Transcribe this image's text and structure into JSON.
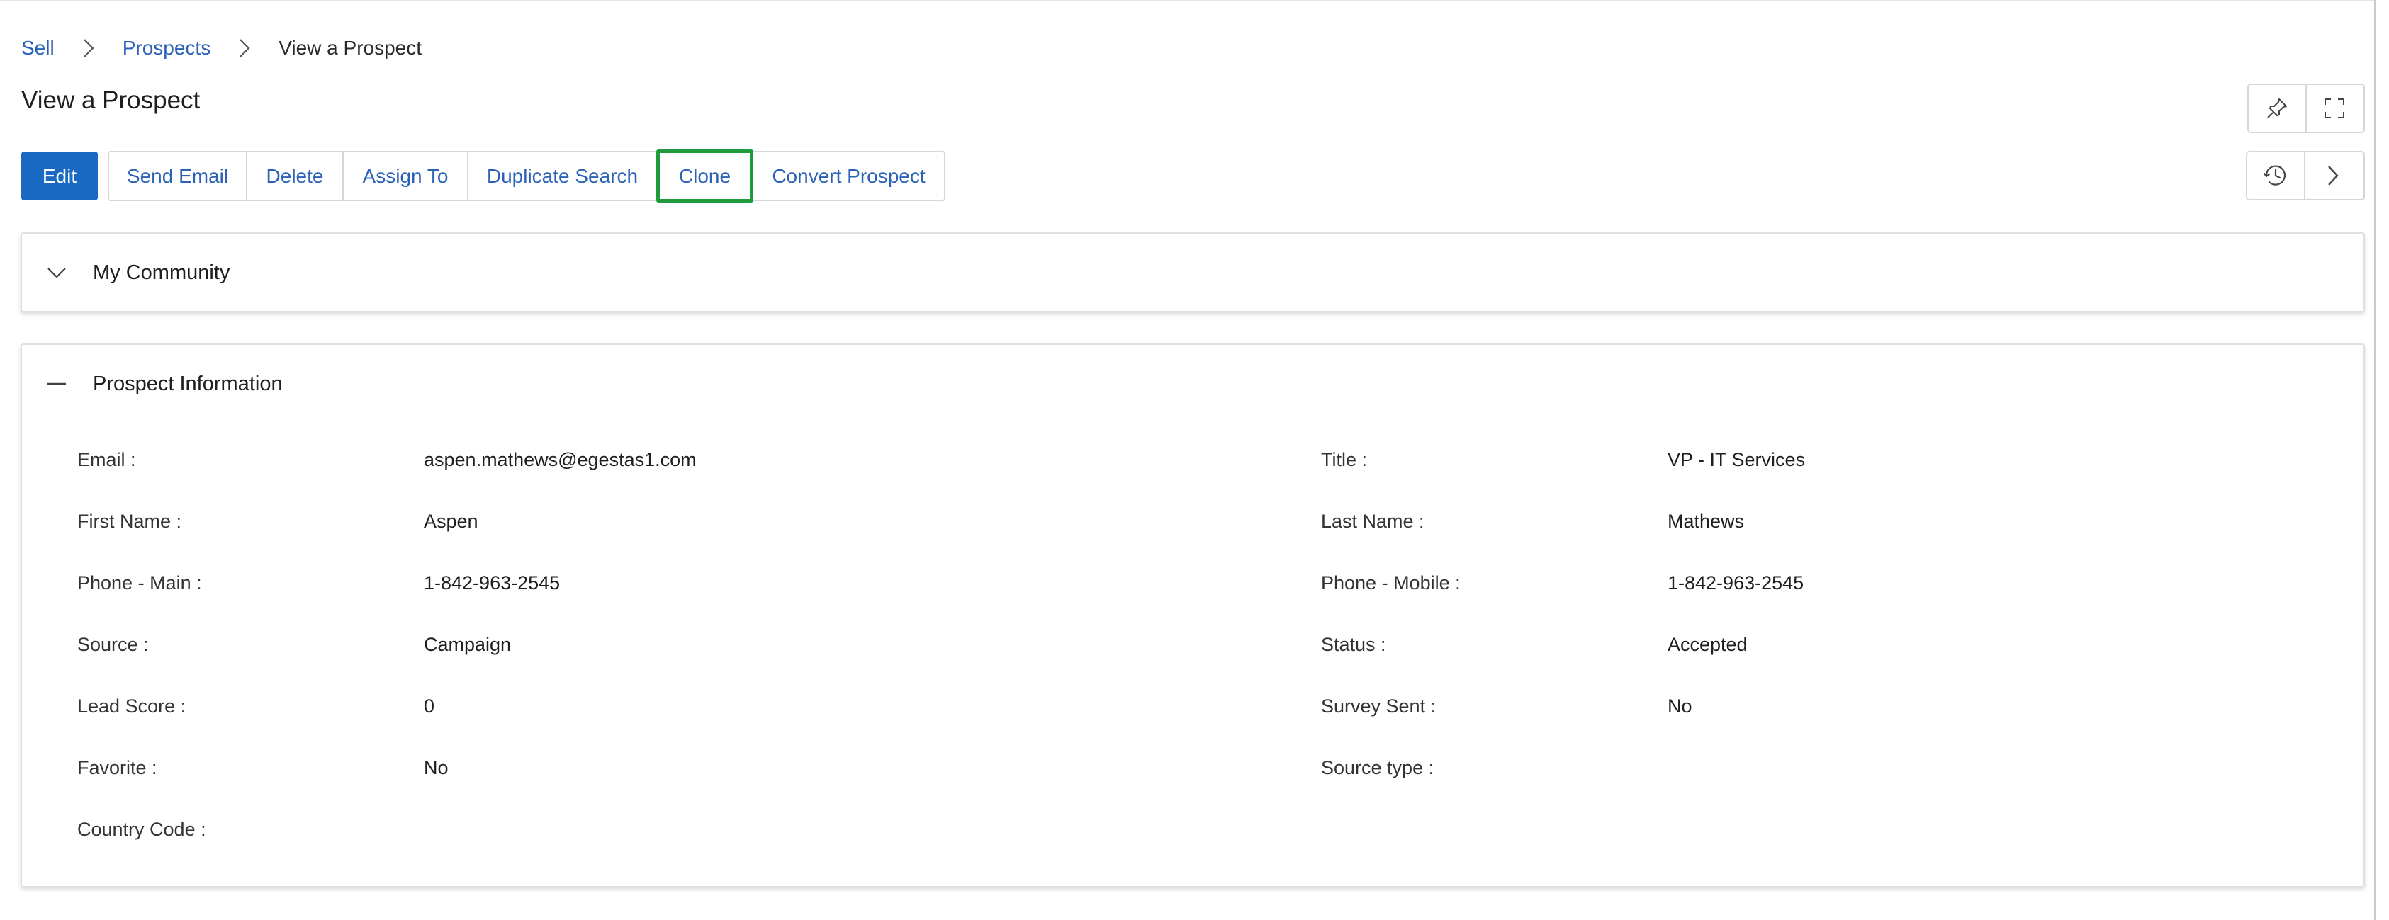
{
  "breadcrumb": {
    "items": [
      "Sell",
      "Prospects"
    ],
    "current": "View a Prospect"
  },
  "page": {
    "title": "View a Prospect"
  },
  "toolbar": {
    "edit": "Edit",
    "actions": [
      "Send Email",
      "Delete",
      "Assign To",
      "Duplicate Search",
      "Clone",
      "Convert Prospect"
    ],
    "highlighted": "Clone"
  },
  "icons": {
    "top": [
      "pin-icon",
      "fullscreen-icon"
    ],
    "bottom": [
      "history-icon",
      "chevron-right-icon"
    ]
  },
  "sections": {
    "community": {
      "title": "My Community",
      "state": "collapsed"
    },
    "info": {
      "title": "Prospect Information",
      "state": "expanded",
      "left": [
        {
          "label": "Email :",
          "value": "aspen.mathews@egestas1.com"
        },
        {
          "label": "First Name :",
          "value": "Aspen"
        },
        {
          "label": "Phone - Main :",
          "value": "1-842-963-2545"
        },
        {
          "label": "Source :",
          "value": "Campaign"
        },
        {
          "label": "Lead Score :",
          "value": "0"
        },
        {
          "label": "Favorite :",
          "value": "No"
        },
        {
          "label": "Country Code :",
          "value": ""
        }
      ],
      "right": [
        {
          "label": "Title :",
          "value": "VP - IT Services"
        },
        {
          "label": "Last Name :",
          "value": "Mathews"
        },
        {
          "label": "Phone - Mobile :",
          "value": "1-842-963-2545"
        },
        {
          "label": "Status :",
          "value": "Accepted"
        },
        {
          "label": "Survey Sent :",
          "value": "No"
        },
        {
          "label": "Source type :",
          "value": ""
        }
      ]
    }
  },
  "colors": {
    "link": "#2b62b8",
    "primary": "#1a69c2",
    "highlight_border": "#1f9a3a"
  }
}
